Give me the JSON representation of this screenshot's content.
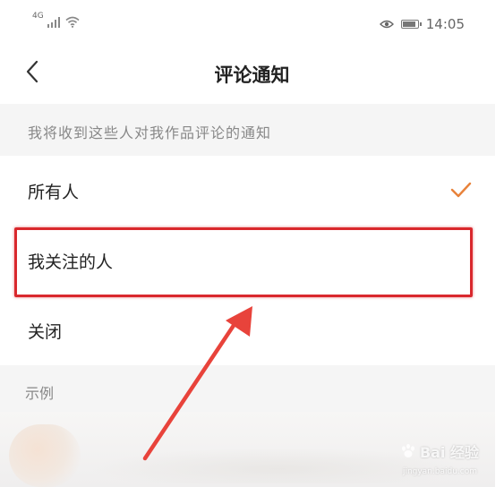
{
  "status_bar": {
    "signal_label": "4G",
    "time": "14:05",
    "icons": [
      "signal-icon",
      "wifi-icon",
      "eye-icon",
      "battery-icon"
    ]
  },
  "nav": {
    "back_icon": "chevron-left-icon",
    "title": "评论通知"
  },
  "section": {
    "header": "我将收到这些人对我作品评论的通知"
  },
  "options": [
    {
      "label": "所有人",
      "selected": true
    },
    {
      "label": "我关注的人",
      "selected": false,
      "highlighted": true
    },
    {
      "label": "关闭",
      "selected": false
    }
  ],
  "example": {
    "header": "示例"
  },
  "watermark": {
    "text": "Bai 经验",
    "sub": "jingyan.baidu.com"
  },
  "colors": {
    "accent_check": "#e8823a",
    "highlight_border": "#d9282d",
    "arrow": "#e8433b",
    "section_bg": "#f5f5f5"
  }
}
